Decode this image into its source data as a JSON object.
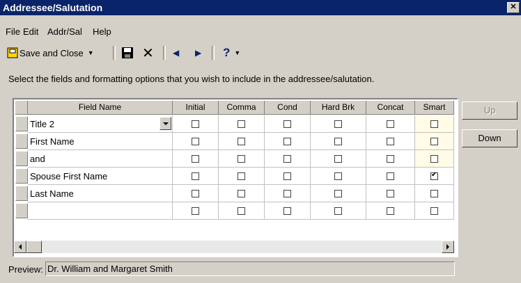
{
  "window": {
    "title": "Addressee/Salutation",
    "close_icon": "close-icon"
  },
  "menu": {
    "items": [
      "File",
      "Edit",
      "Addr/Sal",
      "Help"
    ]
  },
  "toolbar": {
    "save_close_label": "Save and Close",
    "save_icon": "floppy-disk-icon",
    "delete_icon": "x-delete-icon",
    "prev_icon": "arrow-left-icon",
    "next_icon": "arrow-right-icon",
    "help_label": "?"
  },
  "instruction": "Select the fields and formatting options that you wish to include in the addressee/salutation.",
  "grid": {
    "columns": [
      "Field Name",
      "Initial",
      "Comma",
      "Cond",
      "Hard Brk",
      "Concat",
      "Smart"
    ],
    "rows": [
      {
        "field": "Title 2",
        "checks": [
          false,
          false,
          false,
          false,
          false,
          false
        ],
        "dropdown": true
      },
      {
        "field": "First Name",
        "checks": [
          false,
          false,
          false,
          false,
          false,
          false
        ]
      },
      {
        "field": "and",
        "checks": [
          false,
          false,
          false,
          false,
          false,
          false
        ]
      },
      {
        "field": "Spouse First Name",
        "checks": [
          false,
          false,
          false,
          false,
          false,
          true
        ]
      },
      {
        "field": "Last Name",
        "checks": [
          false,
          false,
          false,
          false,
          false,
          false
        ]
      },
      {
        "field": "",
        "checks": [
          false,
          false,
          false,
          false,
          false,
          false
        ]
      }
    ]
  },
  "buttons": {
    "up": "Up",
    "down": "Down"
  },
  "preview": {
    "label": "Preview:",
    "value": "Dr. William and Margaret Smith"
  },
  "colors": {
    "titlebar": "#0a246a",
    "smart_highlight": "#fffbe6"
  }
}
